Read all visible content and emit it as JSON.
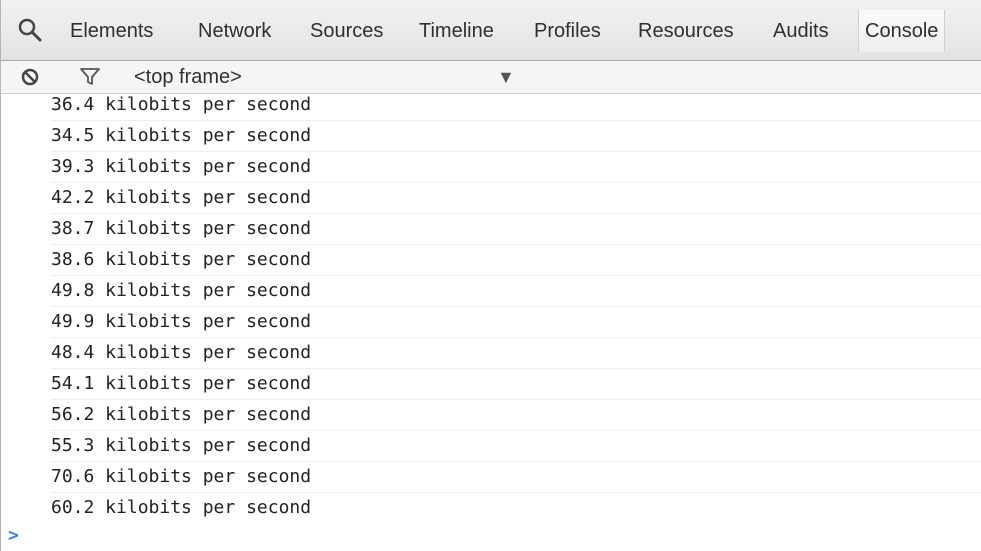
{
  "tabs": [
    {
      "label": "Elements",
      "selected": false
    },
    {
      "label": "Network",
      "selected": false
    },
    {
      "label": "Sources",
      "selected": false
    },
    {
      "label": "Timeline",
      "selected": false
    },
    {
      "label": "Profiles",
      "selected": false
    },
    {
      "label": "Resources",
      "selected": false
    },
    {
      "label": "Audits",
      "selected": false
    },
    {
      "label": "Console",
      "selected": true
    }
  ],
  "toolbar": {
    "search_icon": "magnifier-icon",
    "clear_icon": "clear-console-icon",
    "filter_icon": "filter-icon",
    "frame_selector": "<top frame>",
    "dropdown_icon": "dropdown-arrow-icon"
  },
  "messages": [
    "36.4 kilobits per second",
    "34.5 kilobits per second",
    "39.3 kilobits per second",
    "42.2 kilobits per second",
    "38.7 kilobits per second",
    "38.6 kilobits per second",
    "49.8 kilobits per second",
    "49.9 kilobits per second",
    "48.4 kilobits per second",
    "54.1 kilobits per second",
    "56.2 kilobits per second",
    "55.3 kilobits per second",
    "70.6 kilobits per second",
    "60.2 kilobits per second"
  ],
  "prompt": {
    "symbol": ">",
    "value": ""
  },
  "colors": {
    "accent": "#367cf1",
    "text": "#222222",
    "toolbar": "#e3e3e3"
  }
}
